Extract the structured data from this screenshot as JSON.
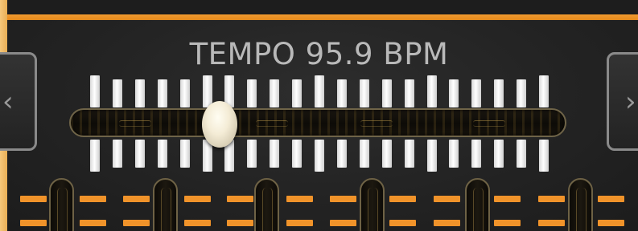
{
  "tempo": {
    "label": "TEMPO 95.9 BPM",
    "bpm": 95.9,
    "slider_position_fraction": 0.29
  },
  "nav": {
    "prev_icon": "chevron-left-icon",
    "next_icon": "chevron-right-icon",
    "prev_glyph": "‹",
    "next_glyph": "›"
  },
  "colors": {
    "accent_orange": "#E98F22",
    "panel_background": "#232323",
    "frame": "#F5C168",
    "tick_white": "#F2F2F2",
    "label_gray": "#B9B9B9"
  }
}
